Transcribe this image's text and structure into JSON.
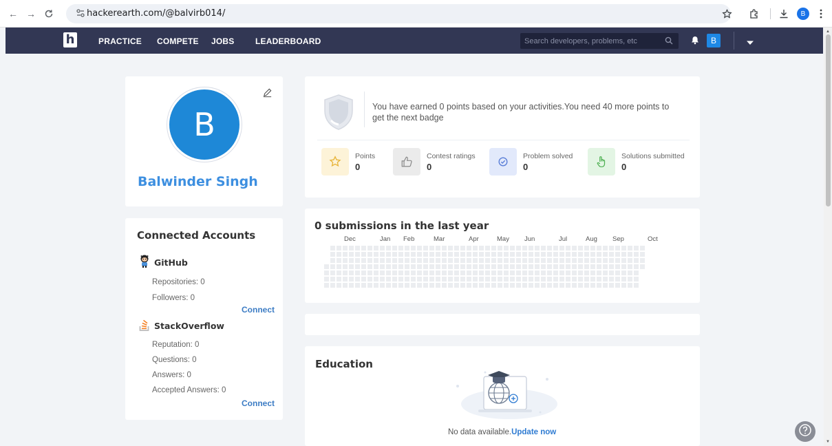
{
  "browser": {
    "url": "hackerearth.com/@balvirb014/",
    "profile_initial": "B"
  },
  "nav": {
    "logo": "h",
    "links": [
      "PRACTICE",
      "COMPETE",
      "JOBS",
      "LEADERBOARD"
    ],
    "search_placeholder": "Search developers, problems, etc",
    "avatar_initial": "B"
  },
  "profile": {
    "initial": "B",
    "name": "Balwinder Singh"
  },
  "accounts": {
    "title": "Connected Accounts",
    "github": {
      "name": "GitHub",
      "repositories": "Repositories: 0",
      "followers": "Followers: 0",
      "connect": "Connect"
    },
    "stackoverflow": {
      "name": "StackOverflow",
      "reputation": "Reputation: 0",
      "questions": "Questions: 0",
      "answers": "Answers: 0",
      "accepted": "Accepted Answers: 0",
      "connect": "Connect"
    }
  },
  "points": {
    "message": "You have earned 0 points based on your activities.You need 40 more points to get the next badge",
    "stats": [
      {
        "label": "Points",
        "value": "0",
        "icon": "star-icon",
        "bg": "#fdf3d8",
        "color": "#e8b53b"
      },
      {
        "label": "Contest ratings",
        "value": "0",
        "icon": "thumbs-up-icon",
        "bg": "#ebebeb",
        "color": "#8a8a8a"
      },
      {
        "label": "Problem solved",
        "value": "0",
        "icon": "check-circle-icon",
        "bg": "#e2e9fb",
        "color": "#5b7fd8"
      },
      {
        "label": "Solutions submitted",
        "value": "0",
        "icon": "hand-pointer-icon",
        "bg": "#e3f5e4",
        "color": "#4caf50"
      }
    ]
  },
  "submissions": {
    "title": "0 submissions in the last year",
    "months": [
      "Dec",
      "Jan",
      "Feb",
      "Mar",
      "Apr",
      "May",
      "Jun",
      "Jul",
      "Aug",
      "Sep",
      "Oct"
    ]
  },
  "education": {
    "title": "Education",
    "message": "No data available.",
    "link": "Update now"
  }
}
